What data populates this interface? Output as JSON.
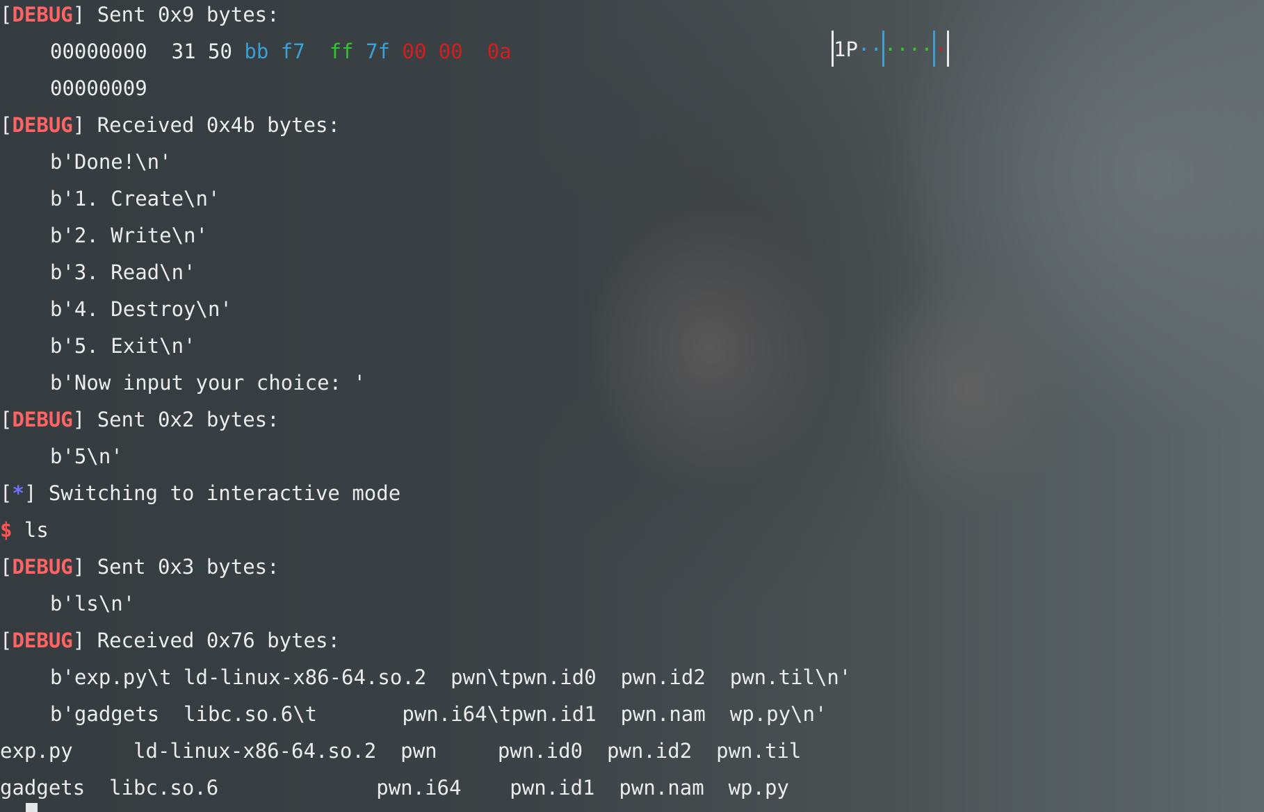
{
  "terminal": {
    "lines": [
      {
        "tag": "DEBUG",
        "text": " Sent 0x9 bytes:"
      },
      {
        "offset": "00000000",
        "bytes": [
          "31",
          "50",
          "bb",
          "f7",
          "ff",
          "7f",
          "00",
          "00",
          "0a"
        ]
      },
      {
        "text": "00000009"
      },
      {
        "tag": "DEBUG",
        "text": " Received 0x4b bytes:"
      },
      {
        "text": "b'Done!\\n'"
      },
      {
        "text": "b'1. Create\\n'"
      },
      {
        "text": "b'2. Write\\n'"
      },
      {
        "text": "b'3. Read\\n'"
      },
      {
        "text": "b'4. Destroy\\n'"
      },
      {
        "text": "b'5. Exit\\n'"
      },
      {
        "text": "b'Now input your choice: '"
      },
      {
        "tag": "DEBUG",
        "text": " Sent 0x2 bytes:"
      },
      {
        "text": "b'5\\n'"
      },
      {
        "tag": "*",
        "text": " Switching to interactive mode"
      },
      {
        "prompt": "$",
        "text": " ls"
      },
      {
        "tag": "DEBUG",
        "text": " Sent 0x3 bytes:"
      },
      {
        "text": "b'ls\\n'"
      },
      {
        "tag": "DEBUG",
        "text": " Received 0x76 bytes:"
      },
      {
        "text": "b'exp.py\\t ld-linux-x86-64.so.2  pwn\\tpwn.id0  pwn.id2  pwn.til\\n'"
      },
      {
        "text": "b'gadgets  libc.so.6\\t       pwn.i64\\tpwn.id1  pwn.nam  wp.py\\n'"
      },
      {
        "text": "exp.py     ld-linux-x86-64.so.2  pwn     pwn.id0  pwn.id2  pwn.til"
      },
      {
        "text": "gadgets  libc.so.6             pwn.i64    pwn.id1  pwn.nam  wp.py"
      }
    ],
    "hexdump_ascii": {
      "printable": "1P",
      "blue_dots": "··",
      "green_dots": "····",
      "red_dot": "·"
    }
  },
  "colors": {
    "debug_tag": "#ff6464",
    "star_tag": "#6f6fff",
    "prompt": "#ff5555",
    "hex_blue": "#3aa0d8",
    "hex_green": "#34c234",
    "hex_red": "#d21e1e",
    "text": "#ececec"
  }
}
